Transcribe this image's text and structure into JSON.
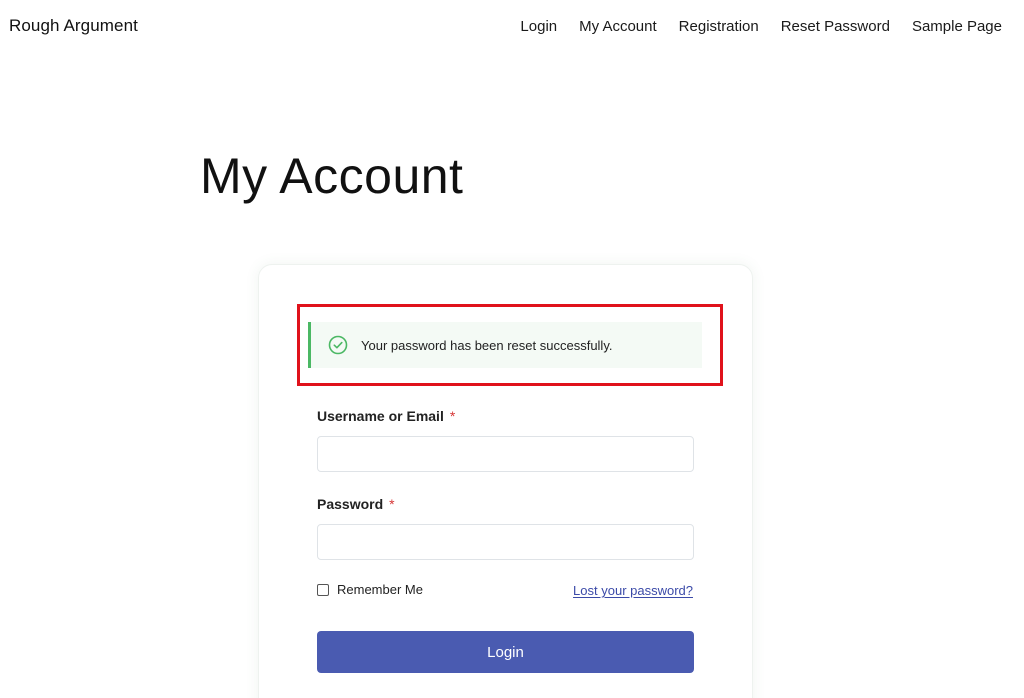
{
  "site": {
    "title": "Rough Argument"
  },
  "nav": {
    "items": [
      {
        "label": "Login"
      },
      {
        "label": "My Account"
      },
      {
        "label": "Registration"
      },
      {
        "label": "Reset Password"
      },
      {
        "label": "Sample Page"
      }
    ]
  },
  "page": {
    "title": "My Account"
  },
  "notice": {
    "message": "Your password has been reset successfully.",
    "icon": "check-circle-icon",
    "accent_color": "#4bb864",
    "highlight_color": "#e0121b"
  },
  "form": {
    "username_label": "Username or Email",
    "password_label": "Password",
    "required_mark": "*",
    "username_value": "",
    "password_value": "",
    "remember_label": "Remember Me",
    "remember_checked": false,
    "lost_password_label": "Lost your password?",
    "login_button_label": "Login",
    "button_color": "#4a5bb1"
  }
}
